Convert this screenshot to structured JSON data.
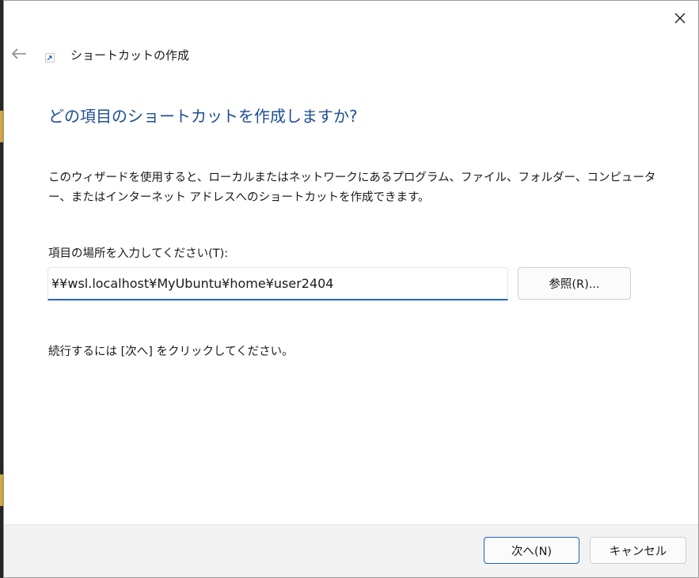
{
  "window": {
    "title": "ショートカットの作成",
    "close_icon": "close-icon",
    "back_icon": "back-arrow-icon",
    "title_icon": "shortcut-icon"
  },
  "main": {
    "heading": "どの項目のショートカットを作成しますか?",
    "description": "このウィザードを使用すると、ローカルまたはネットワークにあるプログラム、ファイル、フォルダー、コンピューター、またはインターネット アドレスへのショートカットを作成できます。",
    "location_label": "項目の場所を入力してください(T):",
    "location_value": "¥¥wsl.localhost¥MyUbuntu¥home¥user2404",
    "browse_label": "参照(R)...",
    "hint": "続行するには [次へ] をクリックしてください。"
  },
  "footer": {
    "next_label": "次へ(N)",
    "cancel_label": "キャンセル"
  },
  "colors": {
    "heading": "#1d4f91",
    "accent": "#2865b8"
  }
}
